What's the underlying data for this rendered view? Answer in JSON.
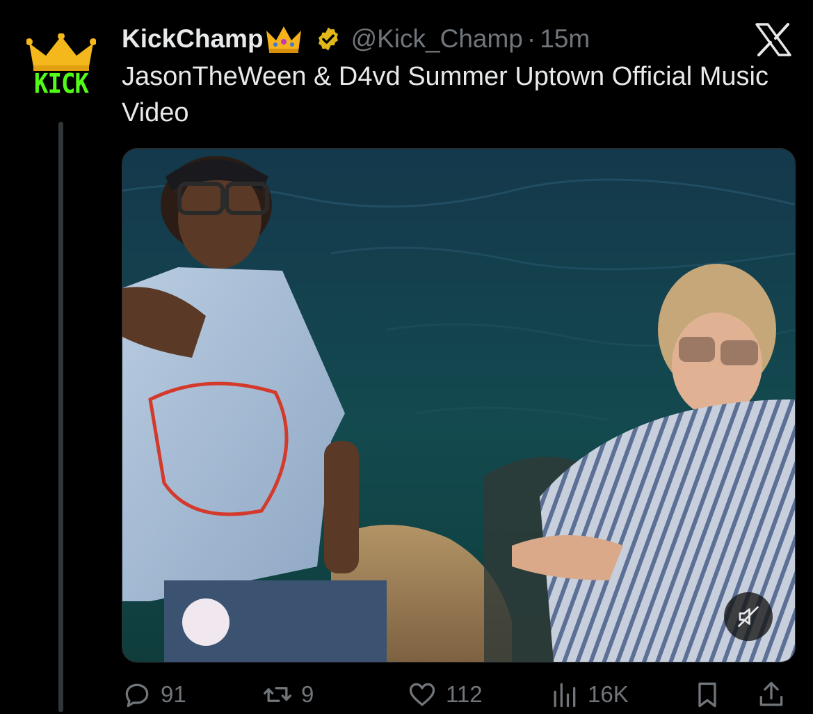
{
  "post": {
    "author": {
      "display_name": "KickChamp",
      "handle": "@Kick_Champ",
      "separator": "·",
      "timestamp": "15m",
      "avatar_text": "KICK",
      "verified": true
    },
    "text": "JasonTheWeen & D4vd Summer Uptown Official Music Video",
    "media": {
      "type": "video",
      "muted": true
    },
    "actions": {
      "replies": "91",
      "reposts": "9",
      "likes": "112",
      "views": "16K"
    }
  },
  "icons": {
    "reply": "speech-bubble-icon",
    "repost": "repost-arrows-icon",
    "like": "heart-icon",
    "views": "bar-chart-icon",
    "bookmark": "bookmark-icon",
    "share": "share-upload-icon",
    "mute": "speaker-muted-icon",
    "platform": "x-logo-icon"
  },
  "colors": {
    "background": "#000000",
    "primary_text": "#e7e9ea",
    "secondary_text": "#71767b",
    "verified_badge": "#e2b719",
    "kick_green": "#53fc18",
    "crown_gold": "#f5b81c"
  }
}
